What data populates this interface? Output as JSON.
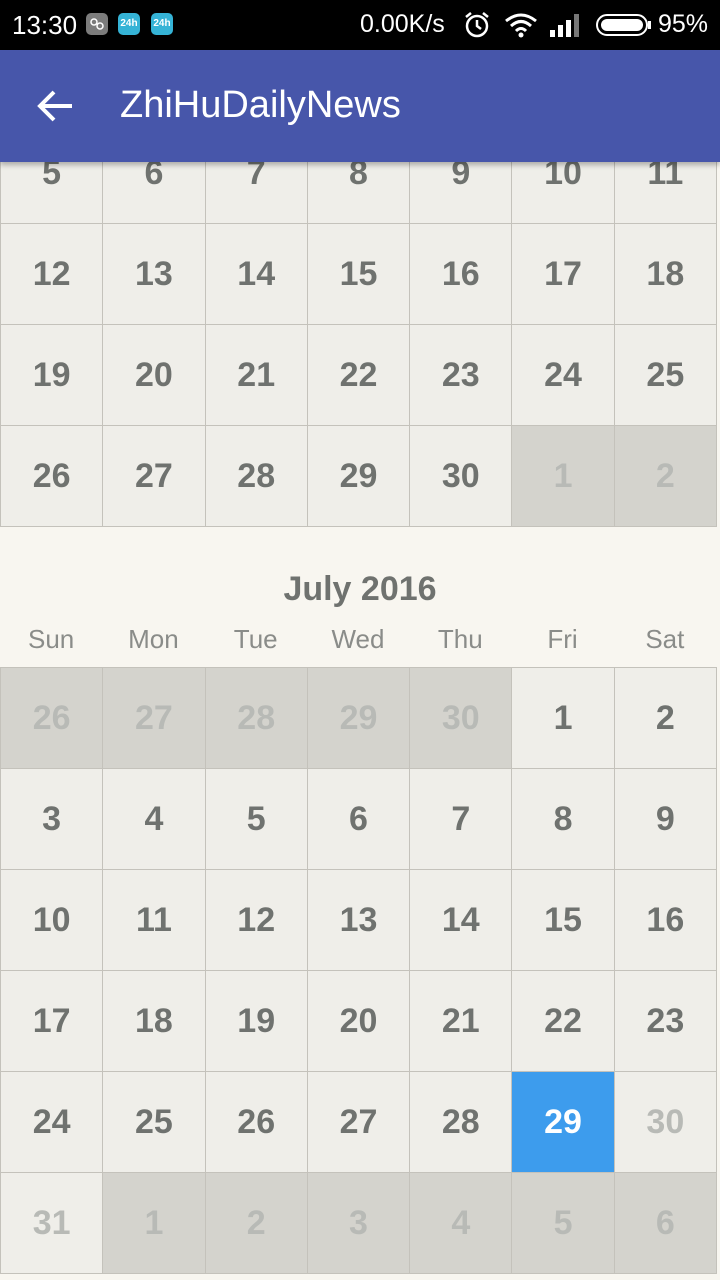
{
  "status_bar": {
    "time": "13:30",
    "notif_icons": [
      "android-icon",
      "24h-icon",
      "24h-icon"
    ],
    "notif_labels": [
      "",
      "24h",
      "24h"
    ],
    "network_speed": "0.00K/s",
    "battery": "95%"
  },
  "app_bar": {
    "title": "ZhiHuDailyNews",
    "color": "#4756AA"
  },
  "previous_month": {
    "rows": [
      [
        {
          "d": "5"
        },
        {
          "d": "6"
        },
        {
          "d": "7"
        },
        {
          "d": "8"
        },
        {
          "d": "9"
        },
        {
          "d": "10"
        },
        {
          "d": "11"
        }
      ],
      [
        {
          "d": "12"
        },
        {
          "d": "13"
        },
        {
          "d": "14"
        },
        {
          "d": "15"
        },
        {
          "d": "16"
        },
        {
          "d": "17"
        },
        {
          "d": "18"
        }
      ],
      [
        {
          "d": "19"
        },
        {
          "d": "20"
        },
        {
          "d": "21"
        },
        {
          "d": "22"
        },
        {
          "d": "23"
        },
        {
          "d": "24"
        },
        {
          "d": "25"
        }
      ],
      [
        {
          "d": "26"
        },
        {
          "d": "27"
        },
        {
          "d": "28"
        },
        {
          "d": "29"
        },
        {
          "d": "30"
        },
        {
          "d": "1",
          "t": "other"
        },
        {
          "d": "2",
          "t": "other"
        }
      ]
    ]
  },
  "month": {
    "title": "July 2016",
    "weekdays": [
      "Sun",
      "Mon",
      "Tue",
      "Wed",
      "Thu",
      "Fri",
      "Sat"
    ],
    "rows": [
      [
        {
          "d": "26",
          "t": "other"
        },
        {
          "d": "27",
          "t": "other"
        },
        {
          "d": "28",
          "t": "other"
        },
        {
          "d": "29",
          "t": "other"
        },
        {
          "d": "30",
          "t": "other"
        },
        {
          "d": "1"
        },
        {
          "d": "2"
        }
      ],
      [
        {
          "d": "3"
        },
        {
          "d": "4"
        },
        {
          "d": "5"
        },
        {
          "d": "6"
        },
        {
          "d": "7"
        },
        {
          "d": "8"
        },
        {
          "d": "9"
        }
      ],
      [
        {
          "d": "10"
        },
        {
          "d": "11"
        },
        {
          "d": "12"
        },
        {
          "d": "13"
        },
        {
          "d": "14"
        },
        {
          "d": "15"
        },
        {
          "d": "16"
        }
      ],
      [
        {
          "d": "17"
        },
        {
          "d": "18"
        },
        {
          "d": "19"
        },
        {
          "d": "20"
        },
        {
          "d": "21"
        },
        {
          "d": "22"
        },
        {
          "d": "23"
        }
      ],
      [
        {
          "d": "24"
        },
        {
          "d": "25"
        },
        {
          "d": "26"
        },
        {
          "d": "27"
        },
        {
          "d": "28"
        },
        {
          "d": "29",
          "t": "selected"
        },
        {
          "d": "30",
          "t": "future"
        }
      ],
      [
        {
          "d": "31",
          "t": "future"
        },
        {
          "d": "1",
          "t": "other"
        },
        {
          "d": "2",
          "t": "other"
        },
        {
          "d": "3",
          "t": "other"
        },
        {
          "d": "4",
          "t": "other"
        },
        {
          "d": "5",
          "t": "other"
        },
        {
          "d": "6",
          "t": "other"
        }
      ]
    ],
    "selected_color": "#3D9CED"
  }
}
